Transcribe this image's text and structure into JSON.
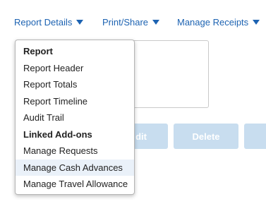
{
  "toolbar": {
    "report_details": "Report Details",
    "print_share": "Print/Share",
    "manage_receipts": "Manage Receipts"
  },
  "buttons": {
    "edit_partial": "dit",
    "delete": "Delete"
  },
  "menu": {
    "items": [
      {
        "label": "Report",
        "type": "header"
      },
      {
        "label": "Report Header",
        "type": "item"
      },
      {
        "label": "Report Totals",
        "type": "item"
      },
      {
        "label": "Report Timeline",
        "type": "item"
      },
      {
        "label": "Audit Trail",
        "type": "item"
      },
      {
        "label": "Linked Add-ons",
        "type": "header"
      },
      {
        "label": "Manage Requests",
        "type": "item"
      },
      {
        "label": "Manage Cash Advances",
        "type": "item",
        "hover": true
      },
      {
        "label": "Manage Travel Allowance",
        "type": "item"
      }
    ]
  },
  "colors": {
    "link": "#1d63b2",
    "button_disabled": "#c8ddef",
    "hover": "#eaf1f9"
  }
}
